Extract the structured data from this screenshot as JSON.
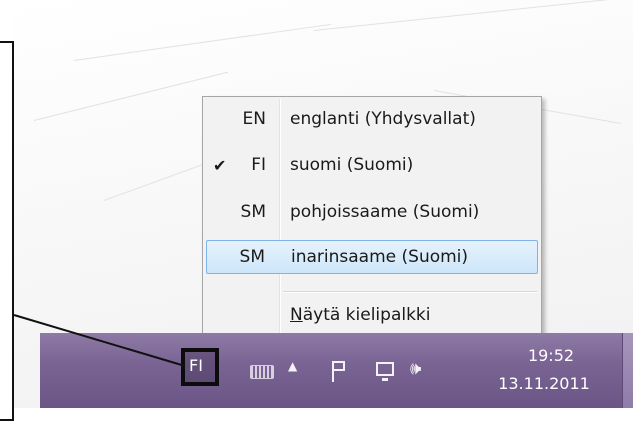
{
  "language_menu": {
    "items": [
      {
        "code": "EN",
        "label": "englanti (Yhdysvallat)",
        "checked": false,
        "highlighted": false
      },
      {
        "code": "FI",
        "label": "suomi (Suomi)",
        "checked": true,
        "highlighted": false
      },
      {
        "code": "SM",
        "label": "pohjoissaame (Suomi)",
        "checked": false,
        "highlighted": false
      },
      {
        "code": "SM",
        "label": "inarinsaame (Suomi)",
        "checked": false,
        "highlighted": true
      }
    ],
    "check_glyph": "✔",
    "show_language_bar": "Näytä kielipalkki"
  },
  "taskbar": {
    "language_indicator": "FI",
    "clock": {
      "time": "19:52",
      "date": "13.11.2011"
    },
    "tray_icons": [
      "keyboard-icon",
      "show-hidden-icons-arrow",
      "action-center-flag-icon",
      "network-icon",
      "volume-icon"
    ],
    "colors": {
      "taskbar": "#7a6494",
      "highlight_border": "#7eb4ea",
      "callout": "#111111"
    }
  }
}
